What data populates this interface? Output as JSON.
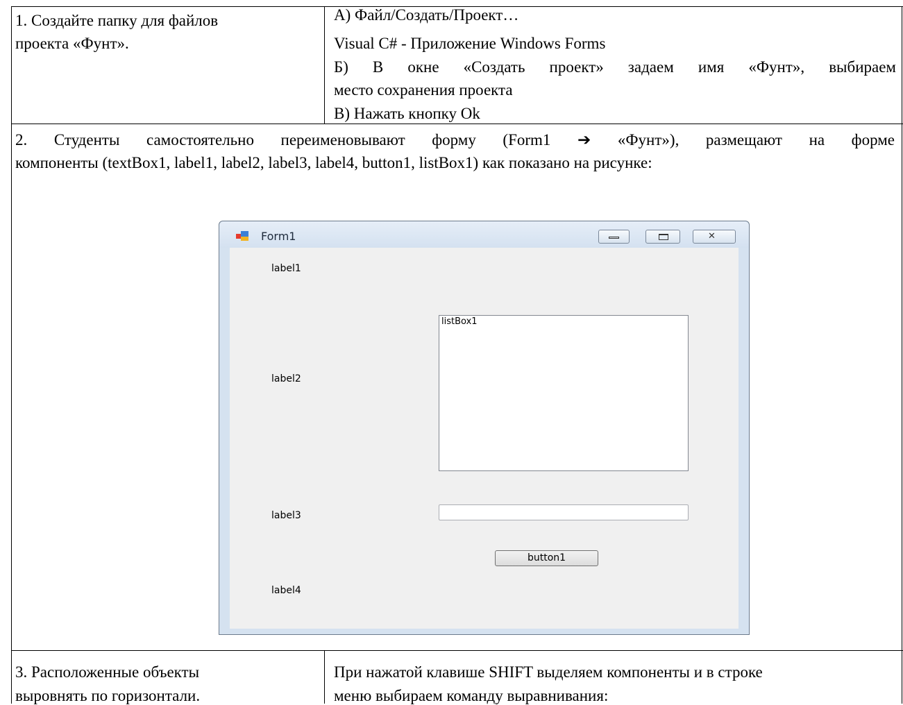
{
  "row1": {
    "left": [
      "1. Создайте папку для файлов",
      "проекта «Фунт»."
    ],
    "right": {
      "a": "А) Файл/Создать/Проект…",
      "a2": "Visual C# - Приложение Windows Forms",
      "b": "Б) В окне «Создать проект» задаем имя «Фунт», выбираем",
      "b2": "место сохранения проекта",
      "c": "В) Нажать кнопку Ok"
    }
  },
  "row2": {
    "line1": "2. Студенты самостоятельно переименовывают форму (Form1 ➔ «Фунт»), размещают на форме",
    "line2": "компоненты (textBox1, label1, label2, label3, label4, button1, listBox1) как показано на рисунке:"
  },
  "form": {
    "title": "Form1",
    "label1": "label1",
    "label2": "label2",
    "label3": "label3",
    "label4": "label4",
    "listbox": "listBox1",
    "textbox": "",
    "button": "button1"
  },
  "row3": {
    "left": [
      "3. Расположенные объекты",
      "выровнять по горизонтали."
    ],
    "right": [
      "При нажатой клавише SHIFT выделяем компоненты и в строке",
      "меню выбираем команду выравнивания:"
    ]
  }
}
